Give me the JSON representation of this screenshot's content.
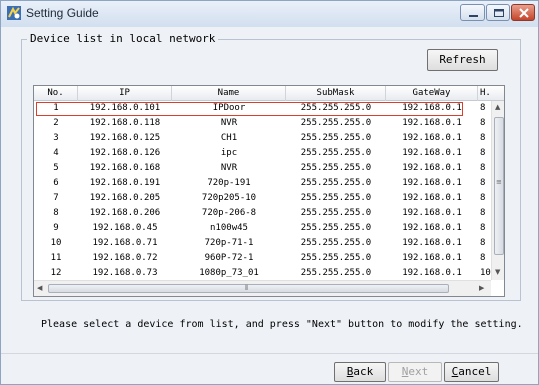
{
  "window": {
    "title": "Setting Guide"
  },
  "group": {
    "legend": "Device list in local network"
  },
  "toolbar": {
    "refresh_label": "Refresh"
  },
  "table": {
    "columns": [
      "No.",
      "IP",
      "Name",
      "SubMask",
      "GateWay",
      "H."
    ],
    "rows": [
      [
        "1",
        "192.168.0.101",
        "IPDoor",
        "255.255.255.0",
        "192.168.0.1",
        "8"
      ],
      [
        "2",
        "192.168.0.118",
        "NVR",
        "255.255.255.0",
        "192.168.0.1",
        "8"
      ],
      [
        "3",
        "192.168.0.125",
        "CH1",
        "255.255.255.0",
        "192.168.0.1",
        "8"
      ],
      [
        "4",
        "192.168.0.126",
        "ipc",
        "255.255.255.0",
        "192.168.0.1",
        "8"
      ],
      [
        "5",
        "192.168.0.168",
        "NVR",
        "255.255.255.0",
        "192.168.0.1",
        "8"
      ],
      [
        "6",
        "192.168.0.191",
        "720p-191",
        "255.255.255.0",
        "192.168.0.1",
        "8"
      ],
      [
        "7",
        "192.168.0.205",
        "720p205-10",
        "255.255.255.0",
        "192.168.0.1",
        "8"
      ],
      [
        "8",
        "192.168.0.206",
        "720p-206-8",
        "255.255.255.0",
        "192.168.0.1",
        "8"
      ],
      [
        "9",
        "192.168.0.45",
        "n100w45",
        "255.255.255.0",
        "192.168.0.1",
        "8"
      ],
      [
        "10",
        "192.168.0.71",
        "720p-71-1",
        "255.255.255.0",
        "192.168.0.1",
        "8"
      ],
      [
        "11",
        "192.168.0.72",
        "960P-72-1",
        "255.255.255.0",
        "192.168.0.1",
        "8"
      ],
      [
        "12",
        "192.168.0.73",
        "1080p_73_01",
        "255.255.255.0",
        "192.168.0.1",
        "10"
      ]
    ],
    "selected_row": 1
  },
  "instructions": "Please select a device from list, and press \"Next\" button to modify the setting.",
  "buttons": {
    "back": {
      "pre": "",
      "ul": "B",
      "post": "ack"
    },
    "next": {
      "pre": "",
      "ul": "N",
      "post": "ext"
    },
    "cancel": {
      "pre": "",
      "ul": "C",
      "post": "ancel"
    }
  },
  "icons": {
    "app": "setting-guide-app-icon",
    "minimize": "minimize-icon",
    "maximize": "maximize-icon",
    "close": "close-icon"
  },
  "colors": {
    "selection_border": "#d6402f",
    "close_button": "#c4442a"
  }
}
